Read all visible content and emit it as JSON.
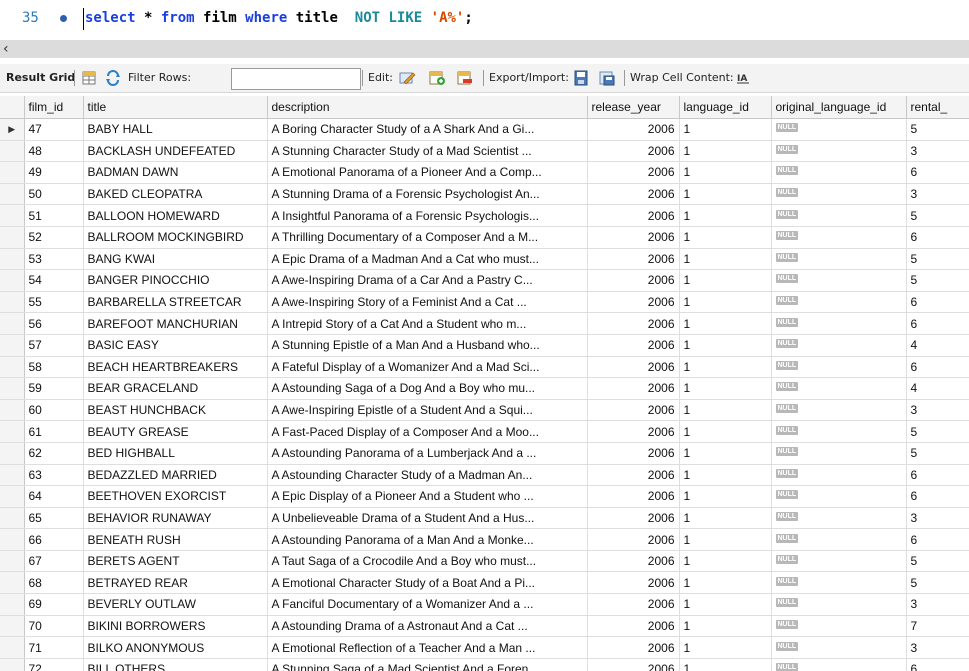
{
  "editor": {
    "line_number": "35",
    "sql": {
      "select": "select",
      "star": " * ",
      "from": "from",
      "table": " film ",
      "where": "where",
      "col": " title  ",
      "not_like": "NOT LIKE",
      "space": " ",
      "str": "'A%'",
      "semi": ";"
    }
  },
  "toolbar": {
    "result_grid": "Result Grid",
    "filter_rows": "Filter Rows:",
    "edit": "Edit:",
    "export_import": "Export/Import:",
    "wrap_cell": "Wrap Cell Content:",
    "filter_value": ""
  },
  "grid": {
    "columns": [
      "film_id",
      "title",
      "description",
      "release_year",
      "language_id",
      "original_language_id",
      "rental_"
    ],
    "null_label": "NULL",
    "rows": [
      [
        "47",
        "BABY HALL",
        "A Boring Character Study of a A Shark And a Gi...",
        "2006",
        "1",
        "5"
      ],
      [
        "48",
        "BACKLASH UNDEFEATED",
        "A Stunning Character Study of a Mad Scientist ...",
        "2006",
        "1",
        "3"
      ],
      [
        "49",
        "BADMAN DAWN",
        "A Emotional Panorama of a Pioneer And a Comp...",
        "2006",
        "1",
        "6"
      ],
      [
        "50",
        "BAKED CLEOPATRA",
        "A Stunning Drama of a Forensic Psychologist An...",
        "2006",
        "1",
        "3"
      ],
      [
        "51",
        "BALLOON HOMEWARD",
        "A Insightful Panorama of a Forensic Psychologis...",
        "2006",
        "1",
        "5"
      ],
      [
        "52",
        "BALLROOM MOCKINGBIRD",
        "A Thrilling Documentary of a Composer And a M...",
        "2006",
        "1",
        "6"
      ],
      [
        "53",
        "BANG KWAI",
        "A Epic Drama of a Madman And a Cat who must...",
        "2006",
        "1",
        "5"
      ],
      [
        "54",
        "BANGER PINOCCHIO",
        "A Awe-Inspiring Drama of a Car And a Pastry C...",
        "2006",
        "1",
        "5"
      ],
      [
        "55",
        "BARBARELLA STREETCAR",
        "A Awe-Inspiring Story of a Feminist And a Cat ...",
        "2006",
        "1",
        "6"
      ],
      [
        "56",
        "BAREFOOT MANCHURIAN",
        "A Intrepid Story of a Cat And a Student who m...",
        "2006",
        "1",
        "6"
      ],
      [
        "57",
        "BASIC EASY",
        "A Stunning Epistle of a Man And a Husband who...",
        "2006",
        "1",
        "4"
      ],
      [
        "58",
        "BEACH HEARTBREAKERS",
        "A Fateful Display of a Womanizer And a Mad Sci...",
        "2006",
        "1",
        "6"
      ],
      [
        "59",
        "BEAR GRACELAND",
        "A Astounding Saga of a Dog And a Boy who mu...",
        "2006",
        "1",
        "4"
      ],
      [
        "60",
        "BEAST HUNCHBACK",
        "A Awe-Inspiring Epistle of a Student And a Squi...",
        "2006",
        "1",
        "3"
      ],
      [
        "61",
        "BEAUTY GREASE",
        "A Fast-Paced Display of a Composer And a Moo...",
        "2006",
        "1",
        "5"
      ],
      [
        "62",
        "BED HIGHBALL",
        "A Astounding Panorama of a Lumberjack And a ...",
        "2006",
        "1",
        "5"
      ],
      [
        "63",
        "BEDAZZLED MARRIED",
        "A Astounding Character Study of a Madman An...",
        "2006",
        "1",
        "6"
      ],
      [
        "64",
        "BEETHOVEN EXORCIST",
        "A Epic Display of a Pioneer And a Student who ...",
        "2006",
        "1",
        "6"
      ],
      [
        "65",
        "BEHAVIOR RUNAWAY",
        "A Unbelieveable Drama of a Student And a Hus...",
        "2006",
        "1",
        "3"
      ],
      [
        "66",
        "BENEATH RUSH",
        "A Astounding Panorama of a Man And a Monke...",
        "2006",
        "1",
        "6"
      ],
      [
        "67",
        "BERETS AGENT",
        "A Taut Saga of a Crocodile And a Boy who must...",
        "2006",
        "1",
        "5"
      ],
      [
        "68",
        "BETRAYED REAR",
        "A Emotional Character Study of a Boat And a Pi...",
        "2006",
        "1",
        "5"
      ],
      [
        "69",
        "BEVERLY OUTLAW",
        "A Fanciful Documentary of a Womanizer And a ...",
        "2006",
        "1",
        "3"
      ],
      [
        "70",
        "BIKINI BORROWERS",
        "A Astounding Drama of a Astronaut And a Cat ...",
        "2006",
        "1",
        "7"
      ],
      [
        "71",
        "BILKO ANONYMOUS",
        "A Emotional Reflection of a Teacher And a Man ...",
        "2006",
        "1",
        "3"
      ],
      [
        "72",
        "BILL OTHERS",
        "A Stunning Saga of a Mad Scientist And a Foren...",
        "2006",
        "1",
        "6"
      ]
    ]
  }
}
